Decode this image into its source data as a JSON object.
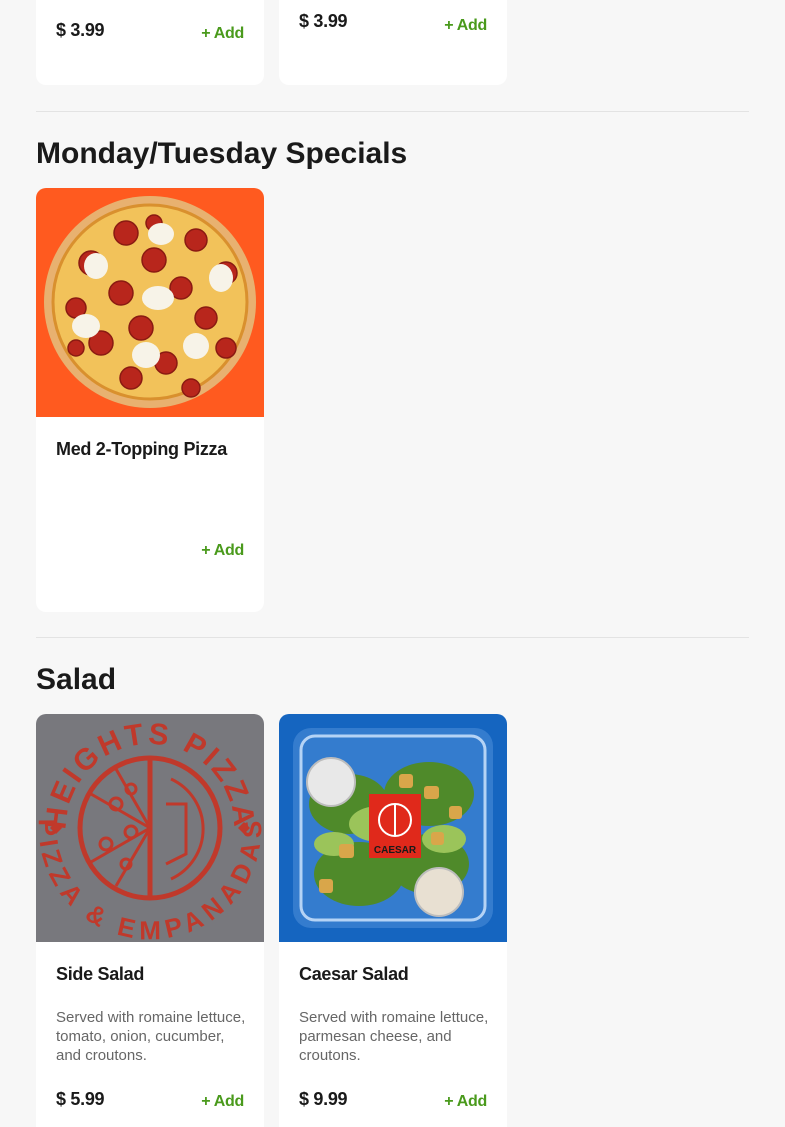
{
  "top_row": [
    {
      "price": "$ 3.99",
      "add_label": "+ Add"
    },
    {
      "price": "$ 3.99",
      "add_label": "+ Add"
    }
  ],
  "sections": [
    {
      "title": "Monday/Tuesday Specials",
      "items": [
        {
          "name": "Med 2-Topping Pizza",
          "add_label": "+ Add",
          "image": "pepperoni-pizza-image"
        }
      ]
    },
    {
      "title": "Salad",
      "items": [
        {
          "name": "Side Salad",
          "description": "Served with romaine lettuce, tomato, onion, cucumber, and croutons.",
          "price": "$ 5.99",
          "add_label": "+ Add",
          "image": "heights-pizza-logo-placeholder",
          "logo_text_top": "HEIGHTS PIZZA",
          "logo_text_bottom": "PIZZA & EMPANADAS"
        },
        {
          "name": "Caesar Salad",
          "description": "Served with romaine lettuce, parmesan cheese, and croutons.",
          "price": "$ 9.99",
          "add_label": "+ Add",
          "image": "caesar-salad-image",
          "sticker_text": "CAESAR"
        }
      ]
    }
  ],
  "colors": {
    "accent_green": "#4a9a1c",
    "pizza_bg": "#ff5a1f",
    "logo_bg": "#78787d",
    "logo_red": "#c0392b",
    "salad_bg": "#1565c0"
  }
}
